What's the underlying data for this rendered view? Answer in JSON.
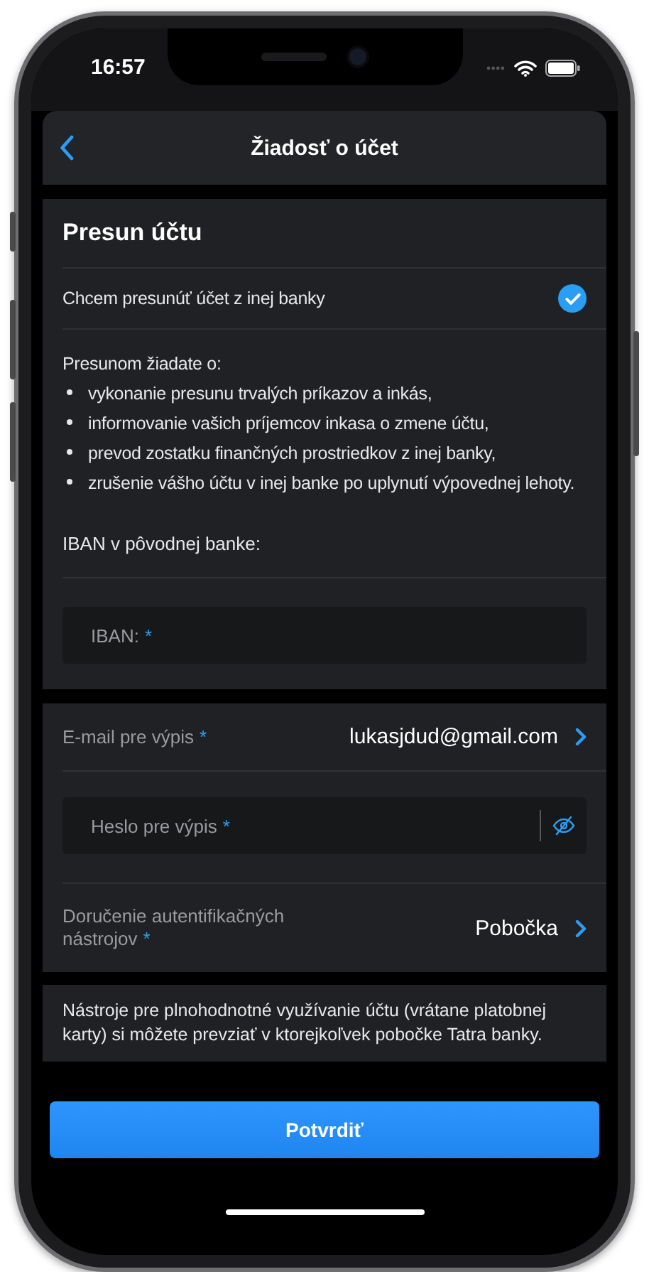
{
  "status_bar": {
    "time": "16:57"
  },
  "nav": {
    "title": "Žiadosť o účet"
  },
  "transfer": {
    "title": "Presun účtu",
    "checkbox": {
      "label": "Chcem presunúť účet z inej banky",
      "checked": true
    },
    "intro": "Presunom žiadate o:",
    "bullets": [
      "vykonanie presunu trvalých príkazov a inkás,",
      "informovanie vašich príjemcov inkasa o zmene účtu,",
      "prevod zostatku finančných prostriedkov z inej banky,",
      "zrušenie vášho účtu v inej banke po uplynutí výpovednej lehoty."
    ],
    "iban_label": "IBAN v pôvodnej banke:",
    "iban_field": {
      "placeholder": "IBAN:",
      "mark": "*"
    }
  },
  "statement": {
    "email": {
      "label": "E-mail pre výpis",
      "mark": "*",
      "value": "lukasjdud@gmail.com"
    },
    "password": {
      "placeholder": "Heslo pre výpis",
      "mark": "*"
    },
    "delivery": {
      "label": "Doručenie autentifikačných nástrojov",
      "mark": "*",
      "value": "Pobočka"
    }
  },
  "note": "Nástroje pre plnohodnotné využívanie účtu (vrátane platobnej karty) si môžete prevziať v ktorejkoľvek pobočke Tatra banky.",
  "confirm_button": "Potvrdiť"
}
